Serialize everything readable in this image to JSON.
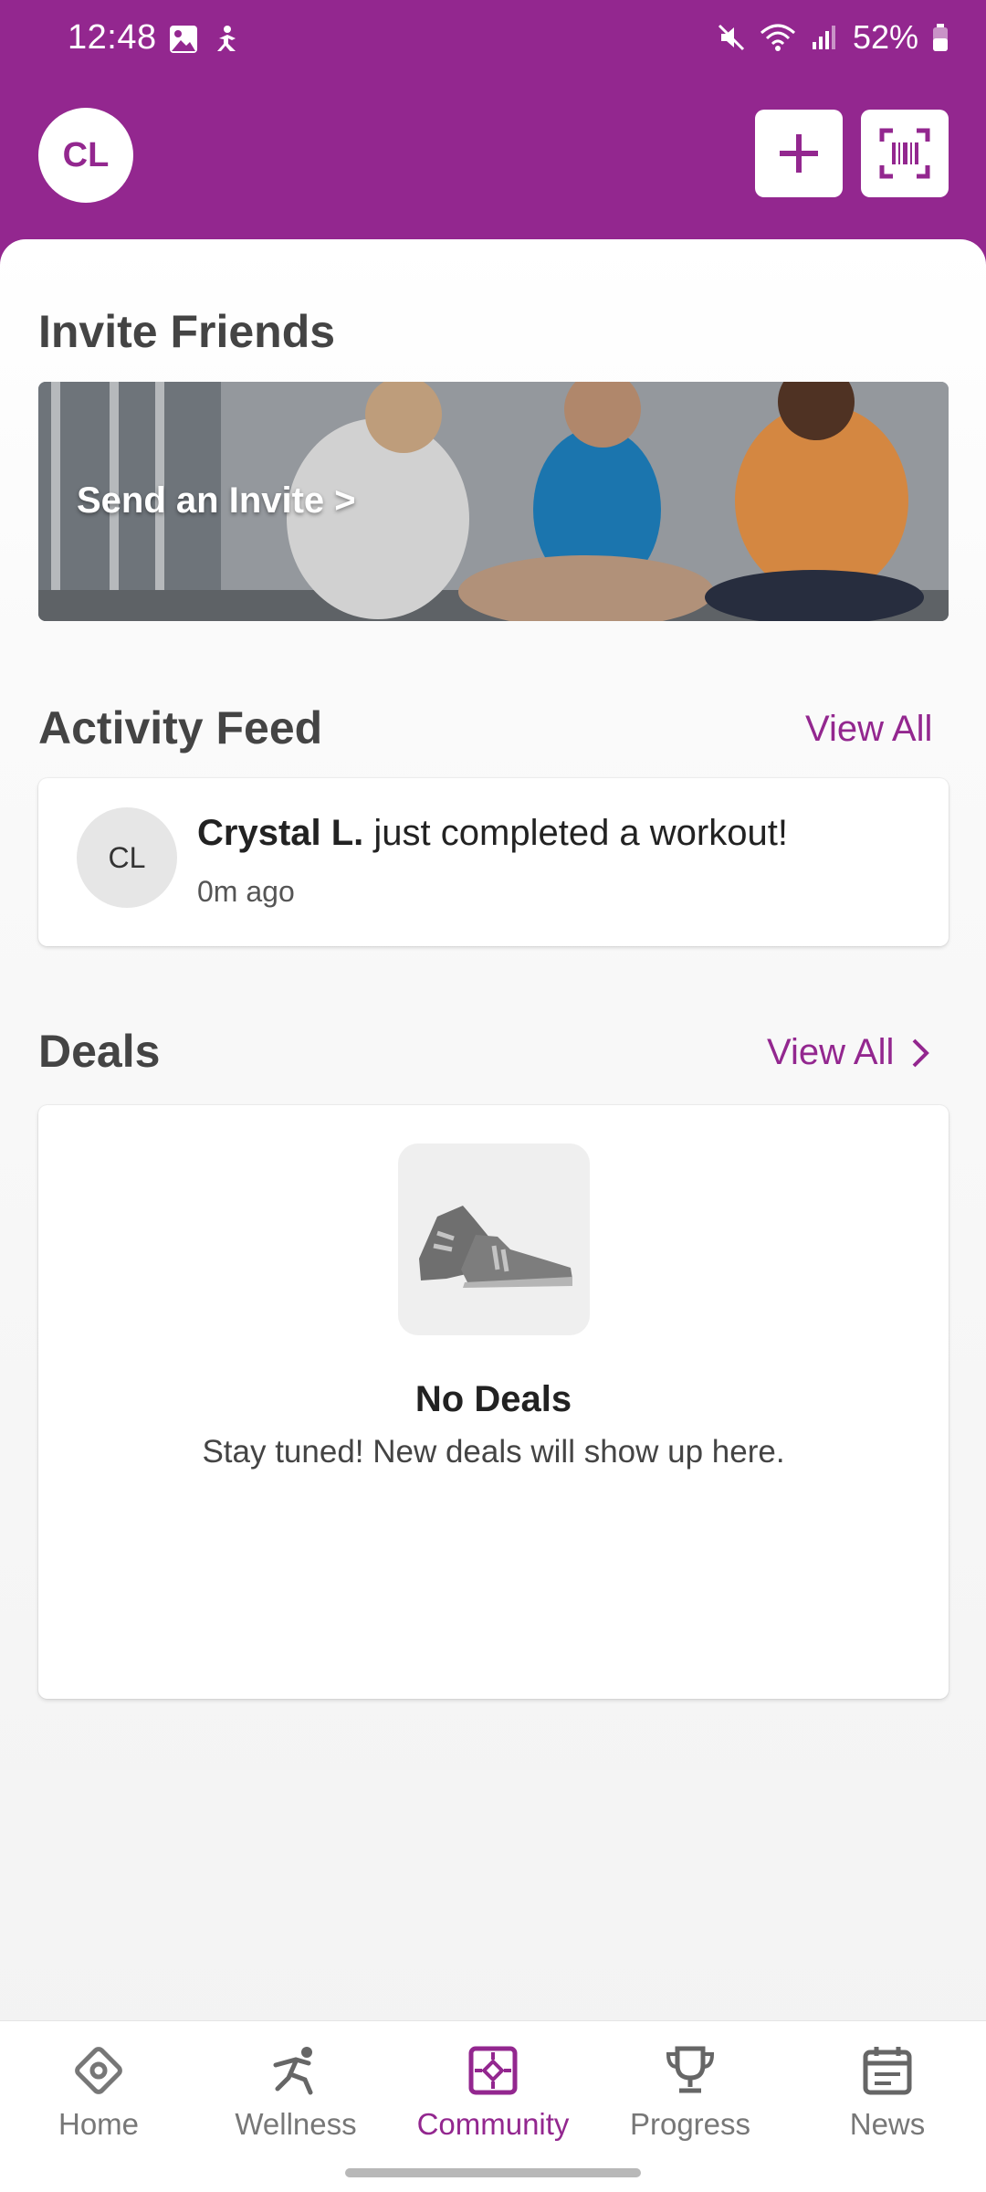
{
  "status_bar": {
    "time": "12:48",
    "battery": "52%"
  },
  "header": {
    "avatar_initials": "CL",
    "add_icon": "plus-icon",
    "scan_icon": "barcode-scan-icon"
  },
  "invite": {
    "title": "Invite Friends",
    "banner_label": "Send an Invite >"
  },
  "activity_feed": {
    "title": "Activity Feed",
    "view_all": "View All",
    "items": [
      {
        "avatar_initials": "CL",
        "name": "Crystal L.",
        "action": " just completed a workout!",
        "time": "0m ago"
      }
    ]
  },
  "deals": {
    "title": "Deals",
    "view_all": "View All",
    "empty_title": "No Deals",
    "empty_message": "Stay tuned! New deals will show up here.",
    "empty_icon": "sneakers-icon"
  },
  "nav": {
    "items": [
      {
        "label": "Home",
        "icon": "home-icon"
      },
      {
        "label": "Wellness",
        "icon": "wellness-icon"
      },
      {
        "label": "Community",
        "icon": "community-icon",
        "active": true
      },
      {
        "label": "Progress",
        "icon": "trophy-icon"
      },
      {
        "label": "News",
        "icon": "calendar-icon"
      }
    ]
  },
  "colors": {
    "brand": "#93278f",
    "background": "#f3f3f3",
    "card": "#ffffff"
  }
}
